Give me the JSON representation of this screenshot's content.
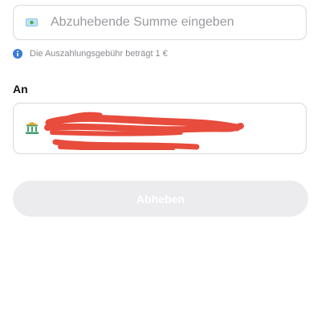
{
  "amount": {
    "placeholder": "Abzuhebende Summe eingeben",
    "value": "",
    "icon": "cash-icon",
    "icon_color": "#8fc5e6"
  },
  "fee": {
    "text": "Die Auszahlungsgebühr beträgt 1 €",
    "icon": "info-icon",
    "icon_color": "#3a7bd5"
  },
  "recipient": {
    "label": "An",
    "icon": "bank-icon",
    "icon_color": "#3f9d6e",
    "account_redacted": true,
    "redaction_color": "#e74c3c"
  },
  "actions": {
    "withdraw_label": "Abheben",
    "withdraw_enabled": false
  }
}
